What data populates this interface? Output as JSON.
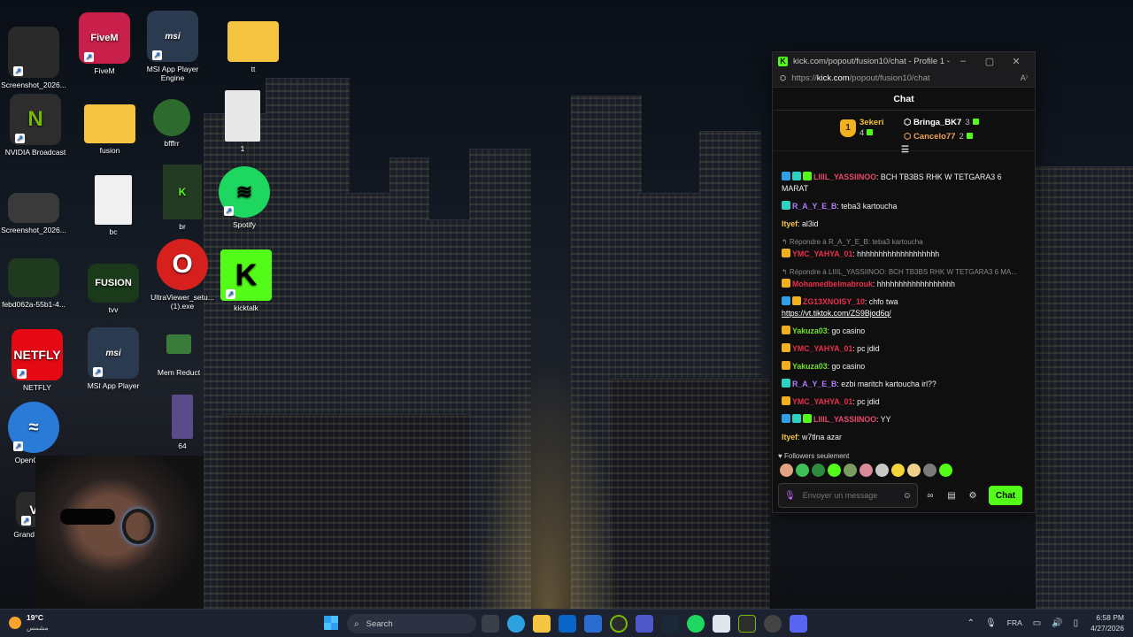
{
  "desktop": {
    "icons": [
      {
        "label": "Screenshot_2026...",
        "color": "#2a2a2a"
      },
      {
        "label": "FiveM",
        "color": "#c8204a"
      },
      {
        "label": "MSI App Player Engine",
        "color": "#2b3b4f"
      },
      {
        "label": "tt",
        "color": "#f5c542"
      },
      {
        "label": "NVIDIA Broadcast",
        "color": "#2d2d2d"
      },
      {
        "label": "fusion",
        "color": "#f5c542"
      },
      {
        "label": "bfffrr",
        "color": "#2d6a2d"
      },
      {
        "label": "1",
        "color": "#e8e8e8"
      },
      {
        "label": "Screenshot_2026...",
        "color": "#3a3a3a"
      },
      {
        "label": "bc",
        "color": "#f0f0f0"
      },
      {
        "label": "br",
        "color": "#233a23"
      },
      {
        "label": "Spotify",
        "color": "#1ed760"
      },
      {
        "label": "febd062a-55b1-4...",
        "color": "#1f3a1f"
      },
      {
        "label": "tvv",
        "color": "#1a3a1a"
      },
      {
        "label": "UltraViewer_setu... (1).exe",
        "color": "#d6201e"
      },
      {
        "label": "kicktalk",
        "color": "#53fc18"
      },
      {
        "label": "NETFLY",
        "color": "#e50914"
      },
      {
        "label": "MSI App Player",
        "color": "#2b3b4f"
      },
      {
        "label": "Mem Reduct",
        "color": "#3a7a3a"
      },
      {
        "label": "OpenOffice",
        "color": "#2a7bd8"
      },
      {
        "label": "64",
        "color": "#5a4a8a"
      },
      {
        "label": "Grand Theft",
        "color": "#2a2a2a"
      }
    ],
    "logos": {
      "fivem": "FiveM",
      "msi": "msi",
      "nvidia": "N",
      "netfly": "NETFLY",
      "fusion": "FUSION",
      "kick": "K"
    }
  },
  "chat_window": {
    "title": "kick.com/popout/fusion10/chat - Profile 1 -...",
    "url_prefix": "https://",
    "url_host": "kick.com",
    "url_path": "/popout/fusion10/chat",
    "header": "Chat",
    "leaderboard": {
      "first": {
        "name": "3ekeri",
        "count": "4"
      },
      "second": {
        "name": "Bringa_BK7",
        "count": "3"
      },
      "third": {
        "name": "Cancelo77",
        "count": "2"
      }
    },
    "messages": [
      {
        "user": "LIIIL_YASSIINOO",
        "color": "#e84a6b",
        "badges": [
          "sub",
          "mod",
          "gift"
        ],
        "text": ": BCH TB3BS RHK W TETGARA3 6 MARAT"
      },
      {
        "user": "R_A_Y_E_B",
        "color": "#b07cff",
        "badges": [
          "mod"
        ],
        "text": ": teba3 kartoucha"
      },
      {
        "user": "Ityef",
        "color": "#f5c542",
        "badges": [],
        "text": ": al3id"
      },
      {
        "reply": "↰ Répondre à R_A_Y_E_B: teba3 kartoucha",
        "user": "YMC_YAHYA_01",
        "color": "#e8304a",
        "badges": [
          "vip"
        ],
        "text": ": hhhhhhhhhhhhhhhhhhh"
      },
      {
        "reply": "↰ Répondre à LIIIL_YASSIINOO: BCH TB3BS RHK W TETGARA3 6 MA...",
        "user": "Mohamedbelmabrouk",
        "color": "#e8304a",
        "badges": [
          "vip"
        ],
        "text": ": hhhhhhhhhhhhhhhhhh"
      },
      {
        "user": "ZG13XNOISY_10",
        "color": "#e8304a",
        "badges": [
          "sub",
          "vip"
        ],
        "text": ": chfo twa",
        "link": "https://vt.tiktok.com/ZS9Bjod6q/"
      },
      {
        "user": "Yakuza03",
        "color": "#74e02c",
        "badges": [
          "vip"
        ],
        "text": ": go casino"
      },
      {
        "user": "YMC_YAHYA_01",
        "color": "#e8304a",
        "badges": [
          "vip"
        ],
        "text": ": pc jdid"
      },
      {
        "user": "Yakuza03",
        "color": "#74e02c",
        "badges": [
          "vip"
        ],
        "text": ": go casino"
      },
      {
        "user": "R_A_Y_E_B",
        "color": "#b07cff",
        "badges": [
          "mod"
        ],
        "text": ": ezbi maritch kartoucha irl??"
      },
      {
        "user": "YMC_YAHYA_01",
        "color": "#e8304a",
        "badges": [
          "vip"
        ],
        "text": ": pc jdid"
      },
      {
        "user": "LIIIL_YASSIINOO",
        "color": "#e84a6b",
        "badges": [
          "sub",
          "mod",
          "gift"
        ],
        "text": ": YY"
      },
      {
        "user": "Ityef",
        "color": "#f5c542",
        "badges": [],
        "text": ": w7tlna azar"
      }
    ],
    "followers_only": "Followers seulement",
    "input_placeholder": "Envoyer un message",
    "send_label": "Chat",
    "accent": "#53fc18"
  },
  "taskbar": {
    "temperature": "19°C",
    "weather_text": "مشمس",
    "search_placeholder": "Search",
    "language": "FRA",
    "time": "6:58 PM",
    "date": "4/27/2026"
  }
}
